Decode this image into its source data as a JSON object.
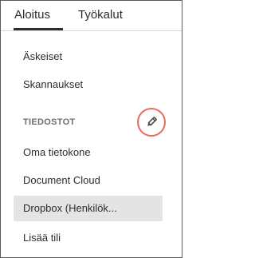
{
  "tabs": [
    {
      "label": "Aloitus",
      "active": true
    },
    {
      "label": "Työkalut",
      "active": false
    }
  ],
  "nav": {
    "recent": "Äskeiset",
    "scans": "Skannaukset"
  },
  "files_section": {
    "title": "TIEDOSTOT",
    "edit_icon": "pencil-icon",
    "items": [
      {
        "label": "Oma tietokone",
        "selected": false
      },
      {
        "label": "Document Cloud",
        "selected": false
      },
      {
        "label": "Dropbox (Henkilök...",
        "selected": true
      },
      {
        "label": "Lisää tili",
        "selected": false
      }
    ]
  },
  "colors": {
    "highlight_ring": "#e86b59",
    "selected_bg": "#e4e4e4",
    "tab_underline": "#2c2c2c"
  }
}
